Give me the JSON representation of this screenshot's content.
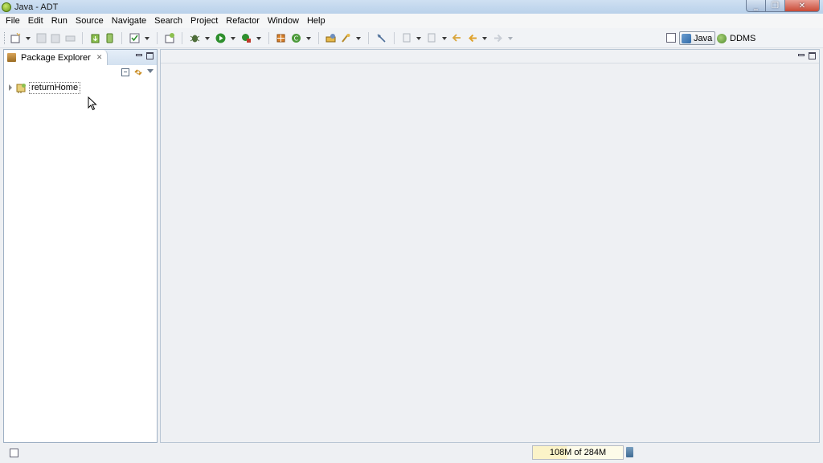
{
  "window": {
    "title": "Java - ADT"
  },
  "menubar": {
    "items": [
      "File",
      "Edit",
      "Run",
      "Source",
      "Navigate",
      "Search",
      "Project",
      "Refactor",
      "Window",
      "Help"
    ]
  },
  "perspectives": {
    "java": "Java",
    "ddms": "DDMS",
    "active": "Java"
  },
  "package_explorer": {
    "title": "Package Explorer",
    "projects": [
      {
        "label": "returnHome"
      }
    ]
  },
  "status": {
    "heap": "108M of 284M"
  },
  "colors": {
    "titlebar": "#cfe0f2",
    "accent": "#2f6aa8",
    "heap_fill": "#fbf3c8"
  }
}
